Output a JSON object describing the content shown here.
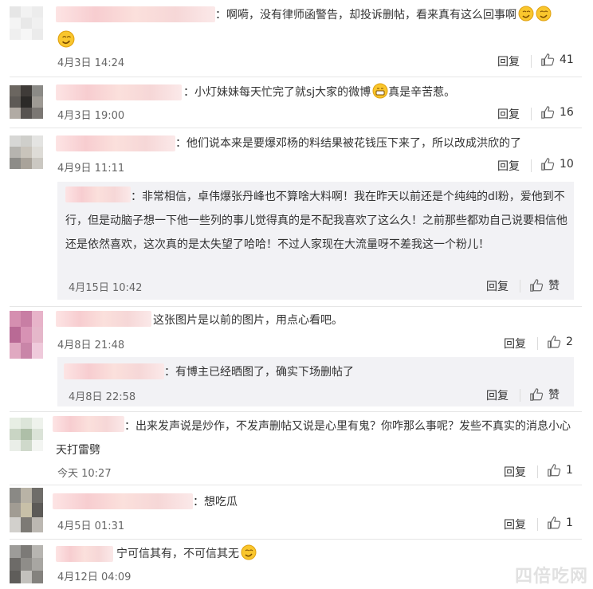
{
  "comments": [
    {
      "text": "：啊嗬，没有律师函警告，却投诉删帖，看来真有这么回事啊",
      "time": "4月3日 14:24",
      "reply": "回复",
      "likes": "41"
    },
    {
      "text": "：小灯妹妹每天忙完了就sj大家的微博",
      "text2": "真是辛苦惹。",
      "time": "4月3日 19:00",
      "reply": "回复",
      "likes": "16"
    },
    {
      "text": "：他们说本来是要爆邓杨的料结果被花钱压下来了，所以改成洪欣的了",
      "time": "4月9日 11:11",
      "reply": "回复",
      "likes": "10"
    },
    {
      "text": "这张图片是以前的图片，用点心看吧。",
      "time": "4月8日 21:48",
      "reply": "回复",
      "likes": "2"
    },
    {
      "text": "：出来发声说是炒作，不发声删帖又说是心里有鬼？你咋那么事呢？发些不真实的消息小心天打雷劈",
      "time": "今天 10:27",
      "reply": "回复",
      "likes": "1"
    },
    {
      "text": "：想吃瓜",
      "time": "4月5日 01:31",
      "reply": "回复",
      "likes": "1"
    },
    {
      "text": "宁可信其有，不可信其无",
      "time": "4月12日 04:09"
    }
  ],
  "subreplies": [
    {
      "text": "：非常相信，卓伟爆张丹峰也不算啥大料啊！我在昨天以前还是个纯纯的dl粉，爱他到不行，但是动脑子想一下他一些列的事儿觉得真的是不配我喜欢了这么久！之前那些都劝自己说要相信他还是依然喜欢，这次真的是太失望了哈哈！不过人家现在大流量呀不差我这一个粉儿！",
      "time": "4月15日 10:42",
      "reply": "回复",
      "like": "赞"
    },
    {
      "text": "：有博主已经晒图了，确实下场删帖了",
      "time": "4月8日 22:58",
      "reply": "回复",
      "like": "赞"
    }
  ],
  "watermark": "四倍吃网",
  "icons": {
    "thumb": "thumbs-up-icon",
    "emoji": "smirk-emoji-icon"
  },
  "colors": {
    "sub_bg": "#f2f2f5",
    "divider": "#e6e6e6",
    "meta": "#666666"
  }
}
